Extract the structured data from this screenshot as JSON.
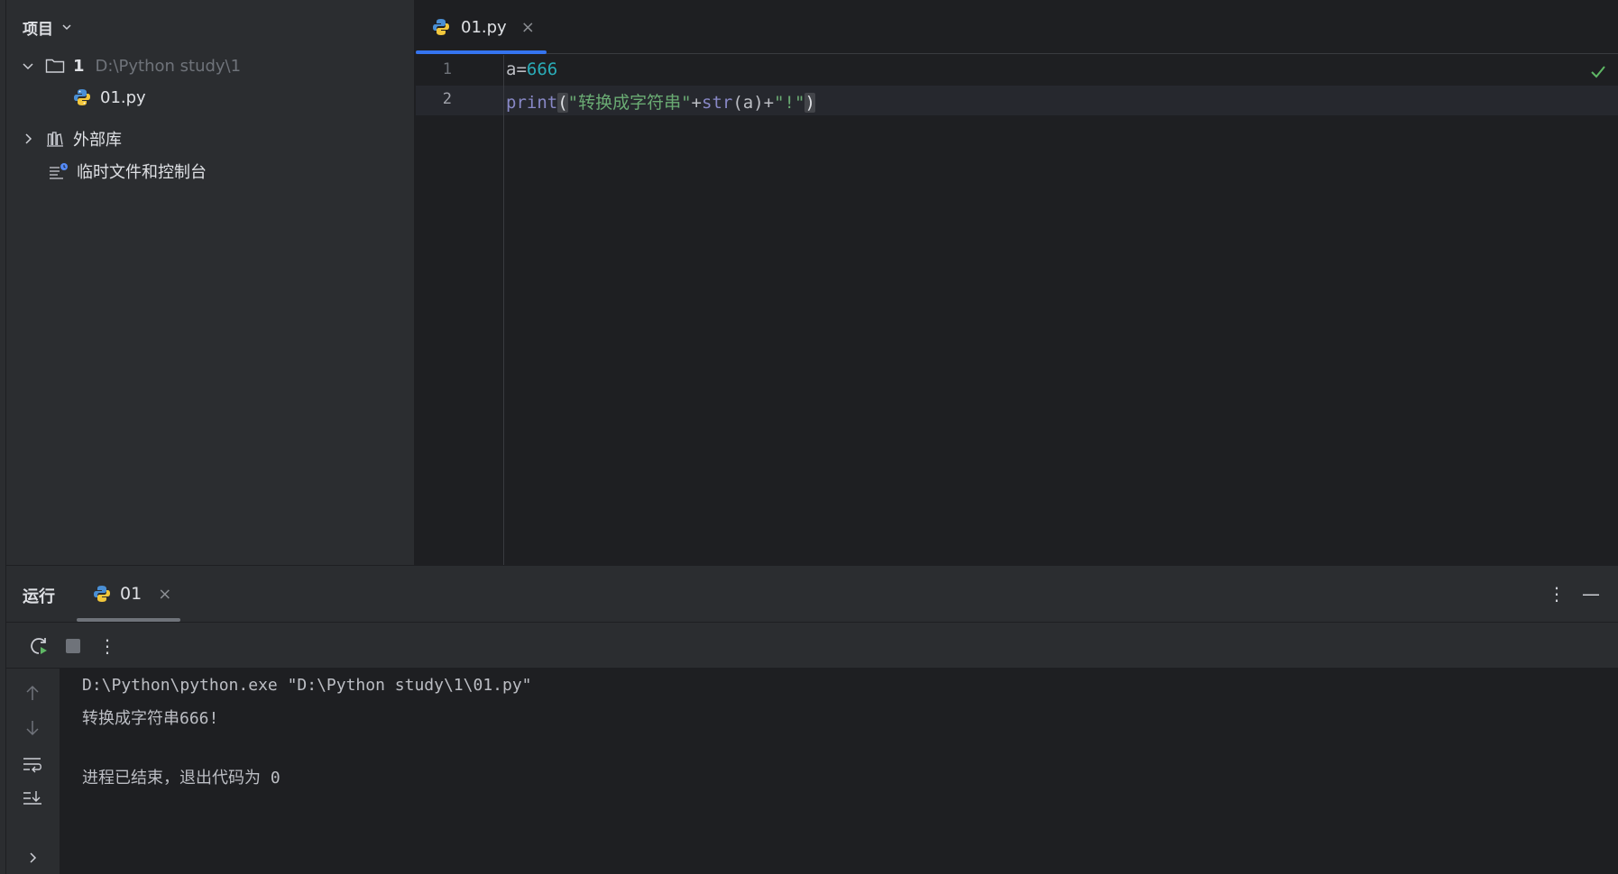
{
  "project_panel": {
    "title": "项目",
    "tree": [
      {
        "label": "1",
        "path": "D:\\Python study\\1"
      },
      {
        "label": "01.py"
      },
      {
        "label": "外部库"
      },
      {
        "label": "临时文件和控制台"
      }
    ]
  },
  "editor": {
    "tab": {
      "label": "01.py",
      "close": "×"
    },
    "line_numbers": [
      "1",
      "2"
    ],
    "code": {
      "line1": {
        "var": "a=",
        "num": "666"
      },
      "line2": {
        "fn1": "print",
        "open": "(",
        "str1": "\"转换成字符串\"",
        "plus1": "+",
        "fn2": "str",
        "arg": "(a)",
        "plus2": "+",
        "str2": "\"!\"",
        "close": ")"
      }
    }
  },
  "run_panel": {
    "title": "运行",
    "tab": {
      "label": "01",
      "close": "×"
    },
    "more": "⋮",
    "minimize": "—",
    "console": [
      "D:\\Python\\python.exe \"D:\\Python study\\1\\01.py\"",
      "转换成字符串666!",
      "",
      "进程已结束，退出代码为 0"
    ]
  },
  "colors": {
    "accent": "#3574f0",
    "panel_bg": "#2b2d30",
    "editor_bg": "#1e1f22",
    "number": "#2aacb8",
    "string": "#6aab73",
    "builtin": "#8888c6",
    "ok": "#5fb865"
  },
  "icons": [
    "chevron-down-icon",
    "folder-icon",
    "python-file-icon",
    "library-icon",
    "scratch-icon",
    "check-icon",
    "rerun-icon",
    "stop-icon",
    "more-icon",
    "arrow-up-icon",
    "arrow-down-icon",
    "soft-wrap-icon",
    "scroll-to-end-icon",
    "chevron-right-icon",
    "minimize-icon"
  ]
}
